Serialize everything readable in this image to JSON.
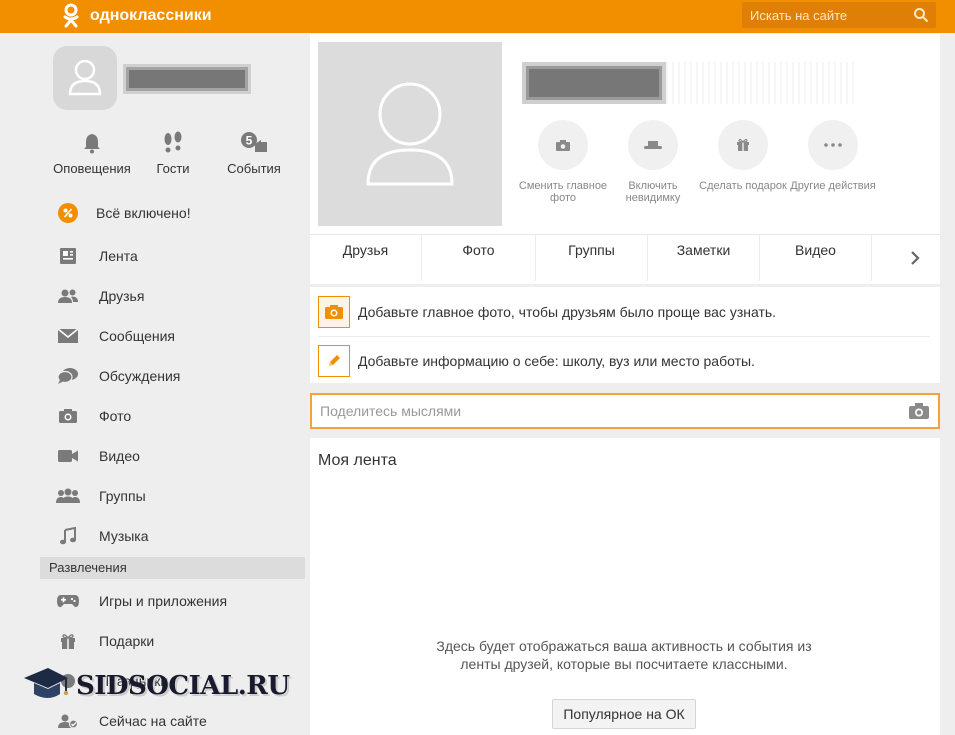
{
  "header": {
    "brand": "одноклассники",
    "search_placeholder": "Искать на сайте"
  },
  "sidebar": {
    "quick": [
      {
        "label": "Оповещения",
        "icon": "bell-icon"
      },
      {
        "label": "Гости",
        "icon": "footprints-icon"
      },
      {
        "label": "События",
        "icon": "events-icon",
        "badge": "5"
      }
    ],
    "all_included": "Всё включено!",
    "items": [
      {
        "label": "Лента",
        "icon": "feed-icon"
      },
      {
        "label": "Друзья",
        "icon": "friends-icon"
      },
      {
        "label": "Сообщения",
        "icon": "envelope-icon"
      },
      {
        "label": "Обсуждения",
        "icon": "discussions-icon"
      },
      {
        "label": "Фото",
        "icon": "camera-icon"
      },
      {
        "label": "Видео",
        "icon": "video-icon"
      },
      {
        "label": "Группы",
        "icon": "groups-icon"
      },
      {
        "label": "Музыка",
        "icon": "music-icon"
      }
    ],
    "entertainment_header": "Развлечения",
    "entertainment": [
      {
        "label": "Игры и приложения",
        "icon": "gamepad-icon"
      },
      {
        "label": "Подарки",
        "icon": "gift-icon"
      },
      {
        "label": "Праздники",
        "icon": "holiday-icon"
      },
      {
        "label": "Сейчас на сайте",
        "icon": "online-users-icon"
      }
    ],
    "watermark": "SIDSOCIAL.RU"
  },
  "profile": {
    "actions": [
      {
        "label": "Сменить главное фото",
        "icon": "camera-icon"
      },
      {
        "label": "Включить невидимку",
        "icon": "hat-icon"
      },
      {
        "label": "Сделать подарок",
        "icon": "gift-icon"
      },
      {
        "label": "Другие действия",
        "icon": "more-icon"
      }
    ],
    "tabs": [
      "Друзья",
      "Фото",
      "Группы",
      "Заметки",
      "Видео"
    ]
  },
  "hints": [
    {
      "text": "Добавьте главное фото, чтобы друзьям было проще вас узнать.",
      "icon": "camera-icon"
    },
    {
      "text": "Добавьте информацию о себе: школу, вуз или место работы.",
      "icon": "pencil-icon"
    }
  ],
  "share": {
    "placeholder": "Поделитесь мыслями"
  },
  "feed": {
    "title": "Моя лента",
    "empty_text": "Здесь будет отображаться ваша активность и события из ленты друзей, которые вы посчитаете классными.",
    "popular_button": "Популярное на ОК"
  },
  "colors": {
    "accent": "#f18f00",
    "icon_gray": "#7a7a7a"
  }
}
